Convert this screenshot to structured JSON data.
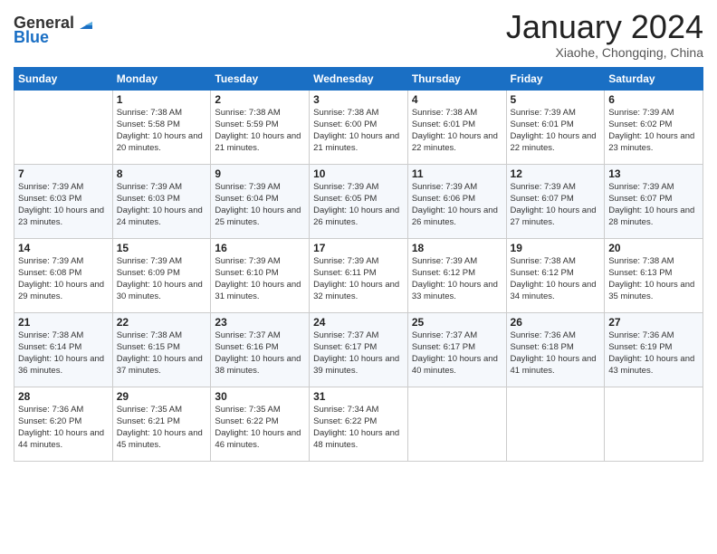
{
  "logo": {
    "general": "General",
    "blue": "Blue"
  },
  "title": "January 2024",
  "subtitle": "Xiaohe, Chongqing, China",
  "weekdays": [
    "Sunday",
    "Monday",
    "Tuesday",
    "Wednesday",
    "Thursday",
    "Friday",
    "Saturday"
  ],
  "weeks": [
    [
      {
        "day": "",
        "sunrise": "",
        "sunset": "",
        "daylight": ""
      },
      {
        "day": "1",
        "sunrise": "Sunrise: 7:38 AM",
        "sunset": "Sunset: 5:58 PM",
        "daylight": "Daylight: 10 hours and 20 minutes."
      },
      {
        "day": "2",
        "sunrise": "Sunrise: 7:38 AM",
        "sunset": "Sunset: 5:59 PM",
        "daylight": "Daylight: 10 hours and 21 minutes."
      },
      {
        "day": "3",
        "sunrise": "Sunrise: 7:38 AM",
        "sunset": "Sunset: 6:00 PM",
        "daylight": "Daylight: 10 hours and 21 minutes."
      },
      {
        "day": "4",
        "sunrise": "Sunrise: 7:38 AM",
        "sunset": "Sunset: 6:01 PM",
        "daylight": "Daylight: 10 hours and 22 minutes."
      },
      {
        "day": "5",
        "sunrise": "Sunrise: 7:39 AM",
        "sunset": "Sunset: 6:01 PM",
        "daylight": "Daylight: 10 hours and 22 minutes."
      },
      {
        "day": "6",
        "sunrise": "Sunrise: 7:39 AM",
        "sunset": "Sunset: 6:02 PM",
        "daylight": "Daylight: 10 hours and 23 minutes."
      }
    ],
    [
      {
        "day": "7",
        "sunrise": "Sunrise: 7:39 AM",
        "sunset": "Sunset: 6:03 PM",
        "daylight": "Daylight: 10 hours and 23 minutes."
      },
      {
        "day": "8",
        "sunrise": "Sunrise: 7:39 AM",
        "sunset": "Sunset: 6:03 PM",
        "daylight": "Daylight: 10 hours and 24 minutes."
      },
      {
        "day": "9",
        "sunrise": "Sunrise: 7:39 AM",
        "sunset": "Sunset: 6:04 PM",
        "daylight": "Daylight: 10 hours and 25 minutes."
      },
      {
        "day": "10",
        "sunrise": "Sunrise: 7:39 AM",
        "sunset": "Sunset: 6:05 PM",
        "daylight": "Daylight: 10 hours and 26 minutes."
      },
      {
        "day": "11",
        "sunrise": "Sunrise: 7:39 AM",
        "sunset": "Sunset: 6:06 PM",
        "daylight": "Daylight: 10 hours and 26 minutes."
      },
      {
        "day": "12",
        "sunrise": "Sunrise: 7:39 AM",
        "sunset": "Sunset: 6:07 PM",
        "daylight": "Daylight: 10 hours and 27 minutes."
      },
      {
        "day": "13",
        "sunrise": "Sunrise: 7:39 AM",
        "sunset": "Sunset: 6:07 PM",
        "daylight": "Daylight: 10 hours and 28 minutes."
      }
    ],
    [
      {
        "day": "14",
        "sunrise": "Sunrise: 7:39 AM",
        "sunset": "Sunset: 6:08 PM",
        "daylight": "Daylight: 10 hours and 29 minutes."
      },
      {
        "day": "15",
        "sunrise": "Sunrise: 7:39 AM",
        "sunset": "Sunset: 6:09 PM",
        "daylight": "Daylight: 10 hours and 30 minutes."
      },
      {
        "day": "16",
        "sunrise": "Sunrise: 7:39 AM",
        "sunset": "Sunset: 6:10 PM",
        "daylight": "Daylight: 10 hours and 31 minutes."
      },
      {
        "day": "17",
        "sunrise": "Sunrise: 7:39 AM",
        "sunset": "Sunset: 6:11 PM",
        "daylight": "Daylight: 10 hours and 32 minutes."
      },
      {
        "day": "18",
        "sunrise": "Sunrise: 7:39 AM",
        "sunset": "Sunset: 6:12 PM",
        "daylight": "Daylight: 10 hours and 33 minutes."
      },
      {
        "day": "19",
        "sunrise": "Sunrise: 7:38 AM",
        "sunset": "Sunset: 6:12 PM",
        "daylight": "Daylight: 10 hours and 34 minutes."
      },
      {
        "day": "20",
        "sunrise": "Sunrise: 7:38 AM",
        "sunset": "Sunset: 6:13 PM",
        "daylight": "Daylight: 10 hours and 35 minutes."
      }
    ],
    [
      {
        "day": "21",
        "sunrise": "Sunrise: 7:38 AM",
        "sunset": "Sunset: 6:14 PM",
        "daylight": "Daylight: 10 hours and 36 minutes."
      },
      {
        "day": "22",
        "sunrise": "Sunrise: 7:38 AM",
        "sunset": "Sunset: 6:15 PM",
        "daylight": "Daylight: 10 hours and 37 minutes."
      },
      {
        "day": "23",
        "sunrise": "Sunrise: 7:37 AM",
        "sunset": "Sunset: 6:16 PM",
        "daylight": "Daylight: 10 hours and 38 minutes."
      },
      {
        "day": "24",
        "sunrise": "Sunrise: 7:37 AM",
        "sunset": "Sunset: 6:17 PM",
        "daylight": "Daylight: 10 hours and 39 minutes."
      },
      {
        "day": "25",
        "sunrise": "Sunrise: 7:37 AM",
        "sunset": "Sunset: 6:17 PM",
        "daylight": "Daylight: 10 hours and 40 minutes."
      },
      {
        "day": "26",
        "sunrise": "Sunrise: 7:36 AM",
        "sunset": "Sunset: 6:18 PM",
        "daylight": "Daylight: 10 hours and 41 minutes."
      },
      {
        "day": "27",
        "sunrise": "Sunrise: 7:36 AM",
        "sunset": "Sunset: 6:19 PM",
        "daylight": "Daylight: 10 hours and 43 minutes."
      }
    ],
    [
      {
        "day": "28",
        "sunrise": "Sunrise: 7:36 AM",
        "sunset": "Sunset: 6:20 PM",
        "daylight": "Daylight: 10 hours and 44 minutes."
      },
      {
        "day": "29",
        "sunrise": "Sunrise: 7:35 AM",
        "sunset": "Sunset: 6:21 PM",
        "daylight": "Daylight: 10 hours and 45 minutes."
      },
      {
        "day": "30",
        "sunrise": "Sunrise: 7:35 AM",
        "sunset": "Sunset: 6:22 PM",
        "daylight": "Daylight: 10 hours and 46 minutes."
      },
      {
        "day": "31",
        "sunrise": "Sunrise: 7:34 AM",
        "sunset": "Sunset: 6:22 PM",
        "daylight": "Daylight: 10 hours and 48 minutes."
      },
      {
        "day": "",
        "sunrise": "",
        "sunset": "",
        "daylight": ""
      },
      {
        "day": "",
        "sunrise": "",
        "sunset": "",
        "daylight": ""
      },
      {
        "day": "",
        "sunrise": "",
        "sunset": "",
        "daylight": ""
      }
    ]
  ]
}
